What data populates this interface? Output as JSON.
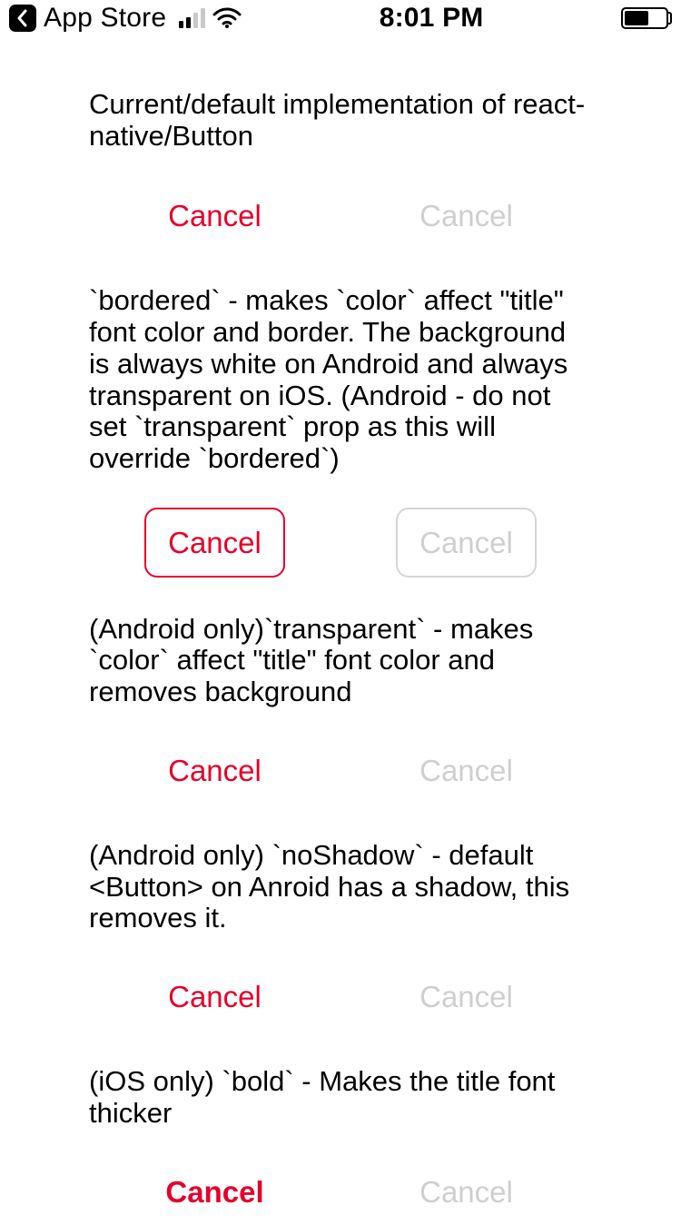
{
  "status": {
    "back_app": "App Store",
    "time": "8:01 PM"
  },
  "colors": {
    "accent": "#e4002b",
    "disabled": "#cfcfd1"
  },
  "sections": [
    {
      "desc": "Current/default implementation of react-native/Button",
      "primary_label": "Cancel",
      "disabled_label": "Cancel",
      "bordered": false,
      "bold": false
    },
    {
      "desc": "`bordered` - makes `color` affect \"title\" font color and border. The background is always white on Android and always transparent on iOS. (Android - do not set `transparent` prop as this will override `bordered`)",
      "primary_label": "Cancel",
      "disabled_label": "Cancel",
      "bordered": true,
      "bold": false
    },
    {
      "desc": "(Android only)`transparent` - makes `color` affect \"title\" font color and removes background",
      "primary_label": "Cancel",
      "disabled_label": "Cancel",
      "bordered": false,
      "bold": false
    },
    {
      "desc": "(Android only) `noShadow` - default <Button> on Anroid has a shadow, this removes it.",
      "primary_label": "Cancel",
      "disabled_label": "Cancel",
      "bordered": false,
      "bold": false
    },
    {
      "desc": "(iOS only) `bold` - Makes the title font thicker",
      "primary_label": "Cancel",
      "disabled_label": "Cancel",
      "bordered": false,
      "bold": true
    }
  ]
}
